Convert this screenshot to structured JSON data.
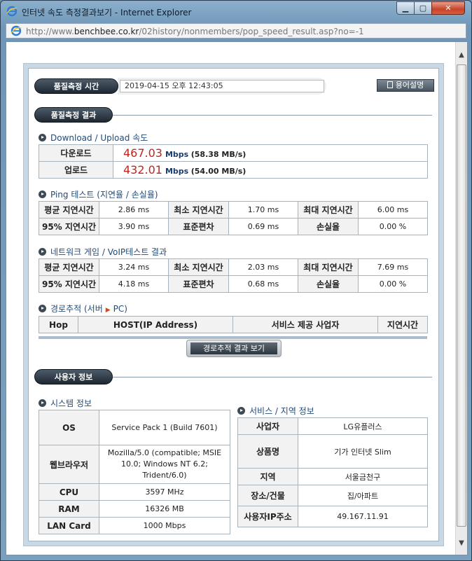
{
  "window": {
    "title": "인터넷 속도 측정결과보기 - Internet Explorer",
    "url_prefix": "http://www.",
    "url_domain": "benchbee.co.kr",
    "url_path": "/02history/nonmembers/pop_speed_result.asp?no=-1",
    "min_label": "▁",
    "max_label": "▢",
    "close_label": "✕"
  },
  "header": {
    "time_pill": "품질측정 시간",
    "time_value": "2019-04-15 오후 12:43:05",
    "help_button": "용어설명",
    "result_pill": "품질측정 결과"
  },
  "speed": {
    "heading": "Download / Upload 속도",
    "rows": [
      {
        "label": "다운로드",
        "mbps": "467.03",
        "unit": "Mbps",
        "mbs": "(58.38 MB/s)"
      },
      {
        "label": "업로드",
        "mbps": "432.01",
        "unit": "Mbps",
        "mbs": "(54.00 MB/s)"
      }
    ]
  },
  "ping": {
    "heading": "Ping 테스트 (지연율 / 손실율)",
    "rows": [
      [
        "평균 지연시간",
        "2.86 ms",
        "최소 지연시간",
        "1.70 ms",
        "최대 지연시간",
        "6.00 ms"
      ],
      [
        "95% 지연시간",
        "3.90 ms",
        "표준편차",
        "0.69 ms",
        "손실율",
        "0.00 %"
      ]
    ]
  },
  "game": {
    "heading": "네트워크 게임 / VoIP테스트 결과",
    "rows": [
      [
        "평균 지연시간",
        "3.24 ms",
        "최소 지연시간",
        "2.03 ms",
        "최대 지연시간",
        "7.69 ms"
      ],
      [
        "95% 지연시간",
        "4.18 ms",
        "표준편차",
        "0.68 ms",
        "손실율",
        "0.00 %"
      ]
    ]
  },
  "trace": {
    "heading_a": "경로추적 (서버",
    "heading_b": "PC)",
    "columns": [
      "Hop",
      "HOST(IP Address)",
      "서비스 제공 사업자",
      "지연시간"
    ],
    "button": "경로추적 결과 보기"
  },
  "user": {
    "pill": "사용자 정보",
    "system_heading": "시스템 정보",
    "system": [
      [
        "OS",
        "Service Pack 1 (Build 7601)"
      ],
      [
        "웹브라우저",
        "Mozilla/5.0 (compatible; MSIE 10.0; Windows NT 6.2; Trident/6.0)"
      ],
      [
        "CPU",
        "3597 MHz"
      ],
      [
        "RAM",
        "16326 MB"
      ],
      [
        "LAN Card",
        "1000 Mbps"
      ]
    ],
    "service_heading": "서비스 / 지역 정보",
    "service": [
      [
        "사업자",
        "LG유플러스"
      ],
      [
        "상품명",
        "기가 인터넷 Slim"
      ],
      [
        "지역",
        "서울금천구"
      ],
      [
        "장소/건물",
        "집/아파트"
      ],
      [
        "사용자IP주소",
        "49.167.11.91"
      ]
    ]
  }
}
